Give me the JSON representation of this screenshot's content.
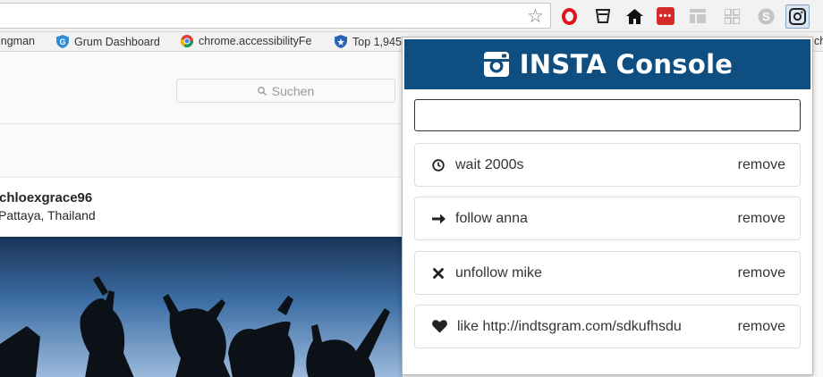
{
  "bookmarks": [
    {
      "label": "ingman",
      "color": ""
    },
    {
      "label": "Grum Dashboard",
      "color": "#2b8ed6"
    },
    {
      "label": "chrome.accessibilityFe",
      "color": "#db4437"
    },
    {
      "label": "Top 1,945",
      "color": "#2a62b8"
    }
  ],
  "page": {
    "search_placeholder": "Suchen",
    "username": "chloexgrace96",
    "location": "Pattaya, Thailand"
  },
  "popup": {
    "title": "INSTA Console",
    "header_color": "#0f4e80",
    "input_value": "",
    "commands": [
      {
        "icon": "clock-icon",
        "text": "wait 2000s",
        "action": "remove"
      },
      {
        "icon": "arrow-right-icon",
        "text": "follow anna",
        "action": "remove"
      },
      {
        "icon": "times-icon",
        "text": "unfollow mike",
        "action": "remove"
      },
      {
        "icon": "heart-icon",
        "text": "like http://indtsgram.com/sdkufhsdu",
        "action": "remove"
      }
    ]
  }
}
